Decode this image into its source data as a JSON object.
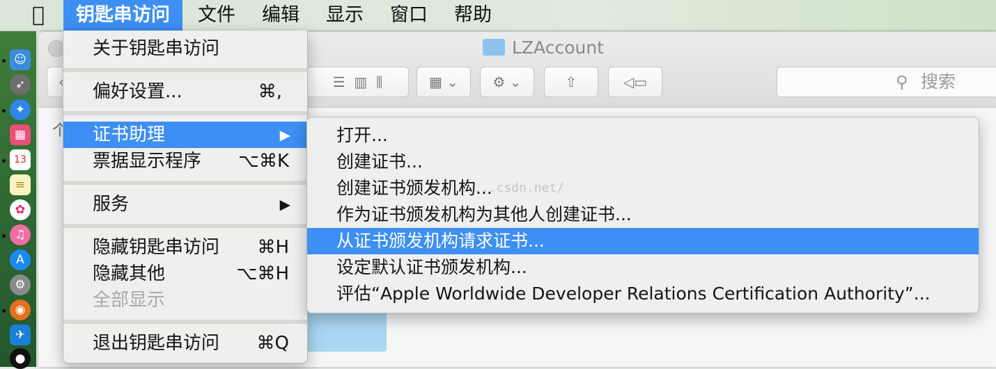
{
  "menubar": {
    "apple_icon": "apple-logo-icon",
    "items": [
      {
        "label": "钥匙串访问",
        "active": true
      },
      {
        "label": "文件"
      },
      {
        "label": "编辑"
      },
      {
        "label": "显示"
      },
      {
        "label": "窗口"
      },
      {
        "label": "帮助"
      }
    ]
  },
  "finder": {
    "title": "LZAccount",
    "search_placeholder": "搜索",
    "sidebar_caret": "个"
  },
  "menu": {
    "about": "关于钥匙串访问",
    "preferences": "偏好设置...",
    "preferences_shortcut": "⌘,",
    "cert_assistant": "证书助理",
    "ticket_viewer": "票据显示程序",
    "ticket_viewer_shortcut": "⌥⌘K",
    "services": "服务",
    "hide": "隐藏钥匙串访问",
    "hide_shortcut": "⌘H",
    "hide_others": "隐藏其他",
    "hide_others_shortcut": "⌥⌘H",
    "show_all": "全部显示",
    "quit": "退出钥匙串访问",
    "quit_shortcut": "⌘Q",
    "submenu_arrow": "▶"
  },
  "submenu": {
    "items": [
      "打开...",
      "创建证书...",
      "创建证书颁发机构...",
      "作为证书颁发机构为其他人创建证书...",
      "从证书颁发机构请求证书...",
      "设定默认证书颁发机构...",
      "评估“Apple Worldwide Developer Relations Certification Authority”..."
    ],
    "highlighted_index": 4
  },
  "watermark": "...csdn.net/",
  "colors": {
    "highlight": "#3d8ff3",
    "menu_bg": "#eef0ec",
    "disabled": "#a8a8a8"
  }
}
